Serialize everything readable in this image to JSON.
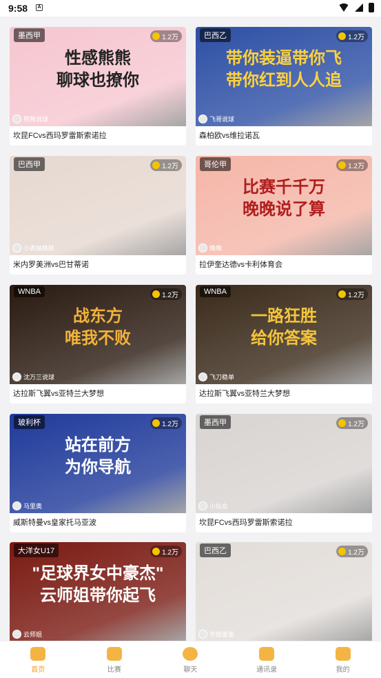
{
  "status_bar": {
    "time": "9:58",
    "notif_glyph": "A"
  },
  "feed": {
    "cards": [
      {
        "league": "墨西甲",
        "heat": "1.2万",
        "anchor": "熊熊说球",
        "title": "坎昆FCvs西玛罗雷斯索诺拉",
        "cover_text": "性感熊熊\n聊球也撩你",
        "bg": "#f6c6d0",
        "fg": "#222222"
      },
      {
        "league": "巴西乙",
        "heat": "1.2万",
        "anchor": "飞哥说球",
        "title": "森柏欧vs维拉诺瓦",
        "cover_text": "带你装逼带你飞\n带你红到人人追",
        "bg": "#2d4fa5",
        "fg": "#ffd23c"
      },
      {
        "league": "巴西甲",
        "heat": "1.2万",
        "anchor": "小表妹桃桃",
        "title": "米内罗美洲vs巴甘蒂诺",
        "cover_text": "",
        "bg": "#e6d8d0",
        "fg": "#222222"
      },
      {
        "league": "哥伦甲",
        "heat": "1.2万",
        "anchor": "晚晚",
        "title": "拉伊奎达德vs卡利体育会",
        "cover_text": "比赛千千万\n晚晚说了算",
        "bg": "#f5b6a8",
        "fg": "#b01e1e"
      },
      {
        "league": "WNBA",
        "heat": "1.2万",
        "anchor": "沈万三说球",
        "title": "达拉斯飞翼vs亚特兰大梦想",
        "cover_text": "战东方\n唯我不败",
        "bg": "#2a1a10",
        "fg": "#f2b33a"
      },
      {
        "league": "WNBA",
        "heat": "1.2万",
        "anchor": "飞刀稳单",
        "title": "达拉斯飞翼vs亚特兰大梦想",
        "cover_text": "一路狂胜\n给你答案",
        "bg": "#3a2a1a",
        "fg": "#f5c53a"
      },
      {
        "league": "玻利杯",
        "heat": "1.2万",
        "anchor": "马里奥",
        "title": "威斯特曼vs皇家托马亚波",
        "cover_text": "站在前方\n为你导航",
        "bg": "#1f3a9a",
        "fg": "#ffffff"
      },
      {
        "league": "墨西甲",
        "heat": "1.2万",
        "anchor": "小仙女",
        "title": "坎昆FCvs西玛罗雷斯索诺拉",
        "cover_text": "",
        "bg": "#d8d4d2",
        "fg": "#222222"
      },
      {
        "league": "大洋女U17",
        "heat": "1.2万",
        "anchor": "云师姐",
        "title": "",
        "cover_text": "\"足球界女中豪杰\"\n云师姐带你起飞",
        "bg": "#7a1a12",
        "fg": "#ffffff"
      },
      {
        "league": "巴西乙",
        "heat": "1.2万",
        "anchor": "学姐董董",
        "title": "",
        "cover_text": "",
        "bg": "#e2ddd9",
        "fg": "#222222"
      }
    ]
  },
  "tabbar": {
    "tabs": [
      {
        "label": "首页",
        "icon": "home-icon"
      },
      {
        "label": "比赛",
        "icon": "match-icon"
      },
      {
        "label": "聊天",
        "icon": "chat-icon"
      },
      {
        "label": "通讯录",
        "icon": "contacts-icon"
      },
      {
        "label": "我的",
        "icon": "profile-icon"
      }
    ],
    "active_color": "#f0a020"
  }
}
